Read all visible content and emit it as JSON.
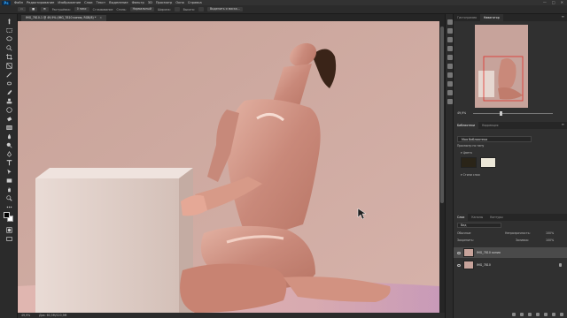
{
  "app": {
    "logo": "Ps"
  },
  "menu": [
    "Файл",
    "Редактирование",
    "Изображение",
    "Слои",
    "Текст",
    "Выделение",
    "Фильтр",
    "3D",
    "Просмотр",
    "Окно",
    "Справка"
  ],
  "window_controls": [
    "—",
    "□",
    "✕"
  ],
  "options": {
    "labels": [
      "Растушёвка:",
      "Стиль:",
      "Ширина:",
      "Высота:"
    ],
    "buttons": [
      "Нормальный",
      "Выделить и маска..."
    ],
    "feather_value": "0 пикс",
    "misc": [
      "Сглаживание"
    ]
  },
  "document": {
    "tab_title": "IMG_7810-1 @ 49,9% (IMG_7810 копия, RGB/8) *",
    "tab_close": "×"
  },
  "status": {
    "zoom": "49,9%",
    "doc_size": "Док: 60,5M/120,9M"
  },
  "panels": {
    "top_tabs": [
      "Гистограмма",
      "Навигатор"
    ],
    "navigator_zoom": "49,9%",
    "mid_tabs": [
      "Библиотеки",
      "Коррекция"
    ],
    "library_name": "Моя библиотека",
    "library_view": "Просмотр по типу",
    "colors_label": "▾ Цвета",
    "color_swatches": [
      "#2a2418",
      "#ece7d8"
    ],
    "styles_label": "▾ Стили слоя",
    "layers_tabs": [
      "Слои",
      "Каналы",
      "Контуры"
    ],
    "search_placeholder": "Вид",
    "blend_mode": "Обычные",
    "opacity_label": "Непрозрачность:",
    "opacity_value": "100%",
    "lock_label": "Закрепить:",
    "fill_label": "Заливка:",
    "fill_value": "100%",
    "layers": [
      {
        "name": "IMG_7810 копия",
        "selected": true
      },
      {
        "name": "IMG_7810",
        "selected": false
      }
    ]
  }
}
